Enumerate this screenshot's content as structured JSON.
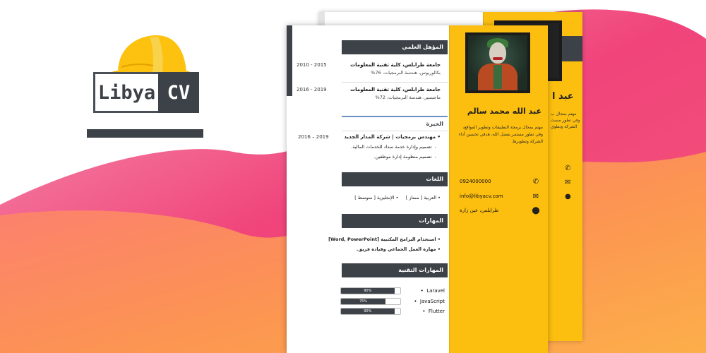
{
  "colors": {
    "accent_yellow": "#fdbf0f",
    "dark_gray": "#3d4248",
    "wave_pink": "#f0447a",
    "wave_orange": "#fda64a"
  },
  "logo": {
    "left_text": "Libya",
    "right_text": "CV",
    "icon": "hard-hat-icon"
  },
  "back_page": {
    "name_fragment": "عبد ا",
    "desc_lines": [
      "مهتم بمجال ب",
      "وفي تطور مست",
      "الشركة وتطوي"
    ]
  },
  "cv": {
    "name": "عبد الله محمد سالم",
    "summary": "مهتم بمجال برمجة التطبيقات وتطوير المواقع، وفي تطور مستمر بفضل الله، هدفي تحسين أداء الشركة وتطويرها.",
    "contacts": [
      {
        "icon": "phone-icon",
        "text": "0924000000"
      },
      {
        "icon": "mail-icon",
        "text": "info@libyacv.com"
      },
      {
        "icon": "location-pin-icon",
        "text": "طرابلس، عين زارة"
      }
    ],
    "education": {
      "heading": "المؤهل العلمي",
      "items": [
        {
          "title": "جامعة طرابلس، كلية تقنية المعلومات",
          "sub": "بكالوريوس، هندسة البرمجيات، 76%",
          "date": "2010 - 2015"
        },
        {
          "title": "جامعة طرابلس، كلية تقنية المعلومات",
          "sub": "ماجستير، هندسة البرمجيات، 72%",
          "date": "2016 - 2019"
        }
      ]
    },
    "experience": {
      "heading": "الخبرة",
      "title": "مهندس برمجيات | شركة المدار الجديد",
      "date": "2016 – 2019",
      "tasks": [
        "تصميم وإدارة خدمة سداد للخدمات المالية.",
        "تصميم منظومة إدارة موظفين."
      ]
    },
    "languages": {
      "heading": "اللغات",
      "items": [
        "العربية [ ممتاز ]",
        "الإنجليزية [ متوسط ]"
      ]
    },
    "skills": {
      "heading": "المهارات",
      "items": [
        "استخدام البرامج المكتبية [Word, PowerPoint]",
        "مهارة العمل الجماعي وقيادة فريق."
      ]
    },
    "tech_skills": {
      "heading": "المهارات التقنية",
      "items": [
        {
          "name": "Laravel",
          "level": 0.9,
          "label": "90%"
        },
        {
          "name": "JavaScript",
          "level": 0.75,
          "label": "75%"
        },
        {
          "name": "Flutter",
          "level": 0.9,
          "label": "90%"
        }
      ]
    }
  }
}
